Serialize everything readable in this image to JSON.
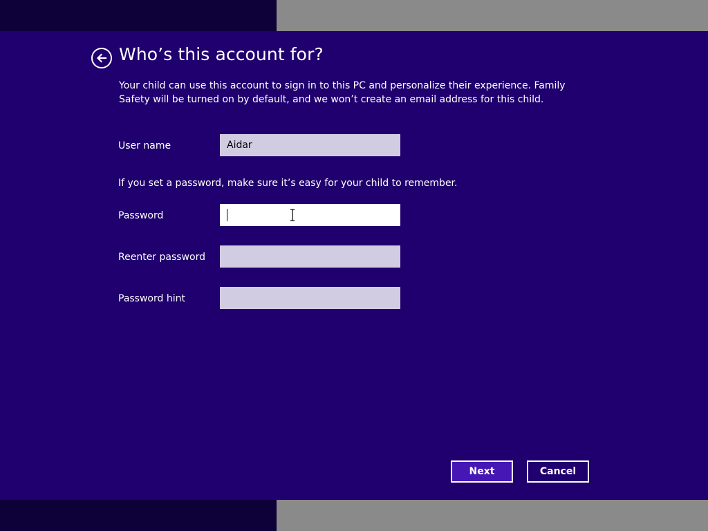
{
  "header": {
    "title": "Who’s this account for?",
    "description": "Your child can use this account to sign in to this PC and personalize their experience. Family Safety will be turned on by default, and we won’t create an email address for this child."
  },
  "form": {
    "username": {
      "label": "User name",
      "value": "Aidar"
    },
    "password_hint_text": "If you set a password, make sure it’s easy for your child to remember.",
    "password": {
      "label": "Password",
      "value": ""
    },
    "reenter_password": {
      "label": "Reenter password",
      "value": ""
    },
    "password_hint": {
      "label": "Password hint",
      "value": ""
    }
  },
  "buttons": {
    "next": "Next",
    "cancel": "Cancel"
  },
  "icons": {
    "back": "back-arrow-icon",
    "cursor": "text-cursor-icon"
  },
  "colors": {
    "background": "#20006e",
    "input_bg": "#d2cce2",
    "input_focused_bg": "#ffffff",
    "primary_button": "#4617b4",
    "band_dark": "#0e0038",
    "band_gray": "#8a8a8a"
  }
}
